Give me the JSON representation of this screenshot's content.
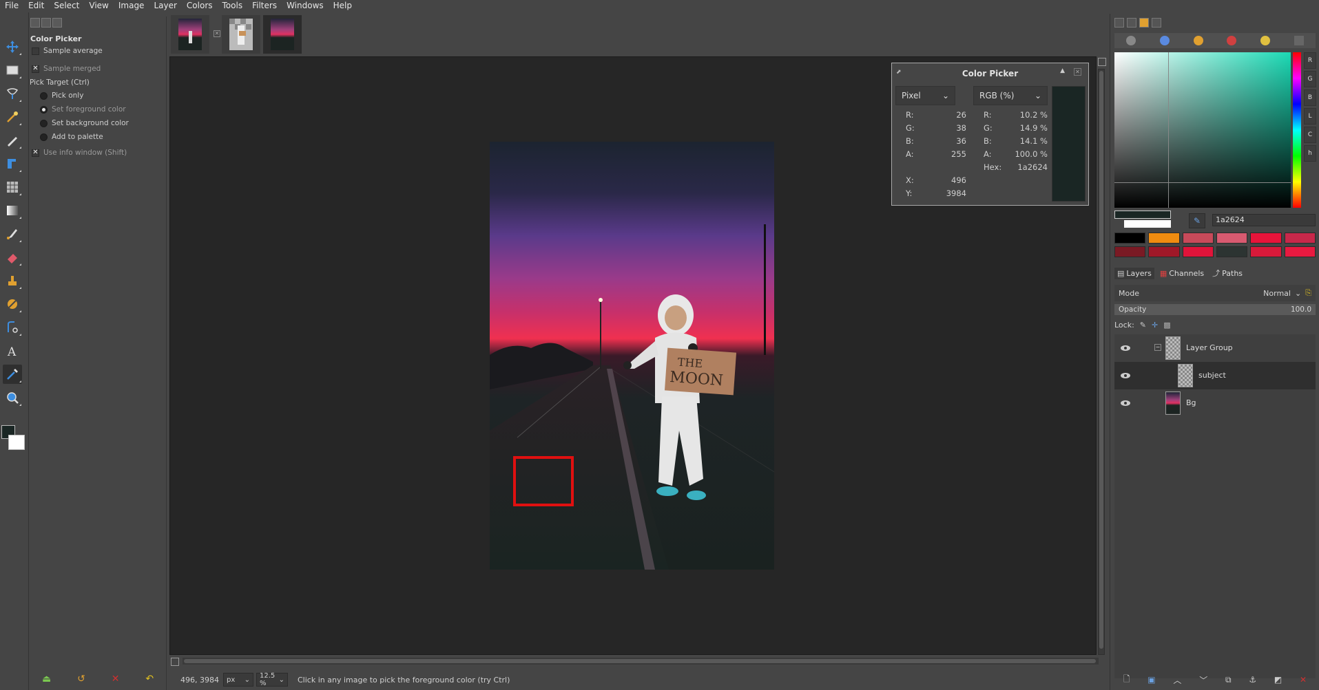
{
  "menubar": [
    "File",
    "Edit",
    "Select",
    "View",
    "Image",
    "Layer",
    "Colors",
    "Tools",
    "Filters",
    "Windows",
    "Help"
  ],
  "tool_options": {
    "title": "Color Picker",
    "sample_average": "Sample average",
    "sample_merged": "Sample merged",
    "pick_target": "Pick Target  (Ctrl)",
    "pick_only": "Pick only",
    "set_foreground": "Set foreground color",
    "set_background": "Set background color",
    "add_to_palette": "Add to palette",
    "use_info_window": "Use info window  (Shift)"
  },
  "color_picker_window": {
    "title": "Color Picker",
    "left_mode": "Pixel",
    "right_mode": "RGB (%)",
    "pixel": {
      "R": "26",
      "G": "38",
      "B": "36",
      "A": "255"
    },
    "percent": {
      "R": "10.2 %",
      "G": "14.9 %",
      "B": "14.1 %",
      "A": "100.0 %",
      "Hex": "1a2624"
    },
    "position": {
      "X": "496",
      "Y": "3984"
    },
    "labels": {
      "R": "R:",
      "G": "G:",
      "B": "B:",
      "A": "A:",
      "Hex": "Hex:",
      "X": "X:",
      "Y": "Y:"
    },
    "swatch_color": "#1a2624"
  },
  "statusbar": {
    "coords": "496, 3984",
    "unit": "px",
    "zoom": "12.5 %",
    "message": "Click in any image to pick the foreground color (try Ctrl)"
  },
  "fg_color": "#1a2624",
  "bg_color": "#ffffff",
  "color_dock": {
    "hex_value": "1a2624",
    "channel_buttons": [
      "R",
      "G",
      "B",
      "L",
      "C",
      "h"
    ],
    "history": [
      "#000000",
      "#f08c10",
      "#c84a5a",
      "#d85a70",
      "#e8143a",
      "#c8284a",
      "#7a1a24",
      "#a01828",
      "#e0143a",
      "#2c3432",
      "#d81a3a",
      "#e81a40"
    ]
  },
  "layers_panel": {
    "tabs": [
      "Layers",
      "Channels",
      "Paths"
    ],
    "mode_label": "Mode",
    "mode_value": "Normal",
    "opacity_label": "Opacity",
    "opacity_value": "100.0",
    "lock_label": "Lock:",
    "layers": [
      {
        "name": "Layer Group"
      },
      {
        "name": "subject"
      },
      {
        "name": "Bg"
      }
    ]
  },
  "photo_text": {
    "line1": "THE",
    "line2": "MOON"
  }
}
